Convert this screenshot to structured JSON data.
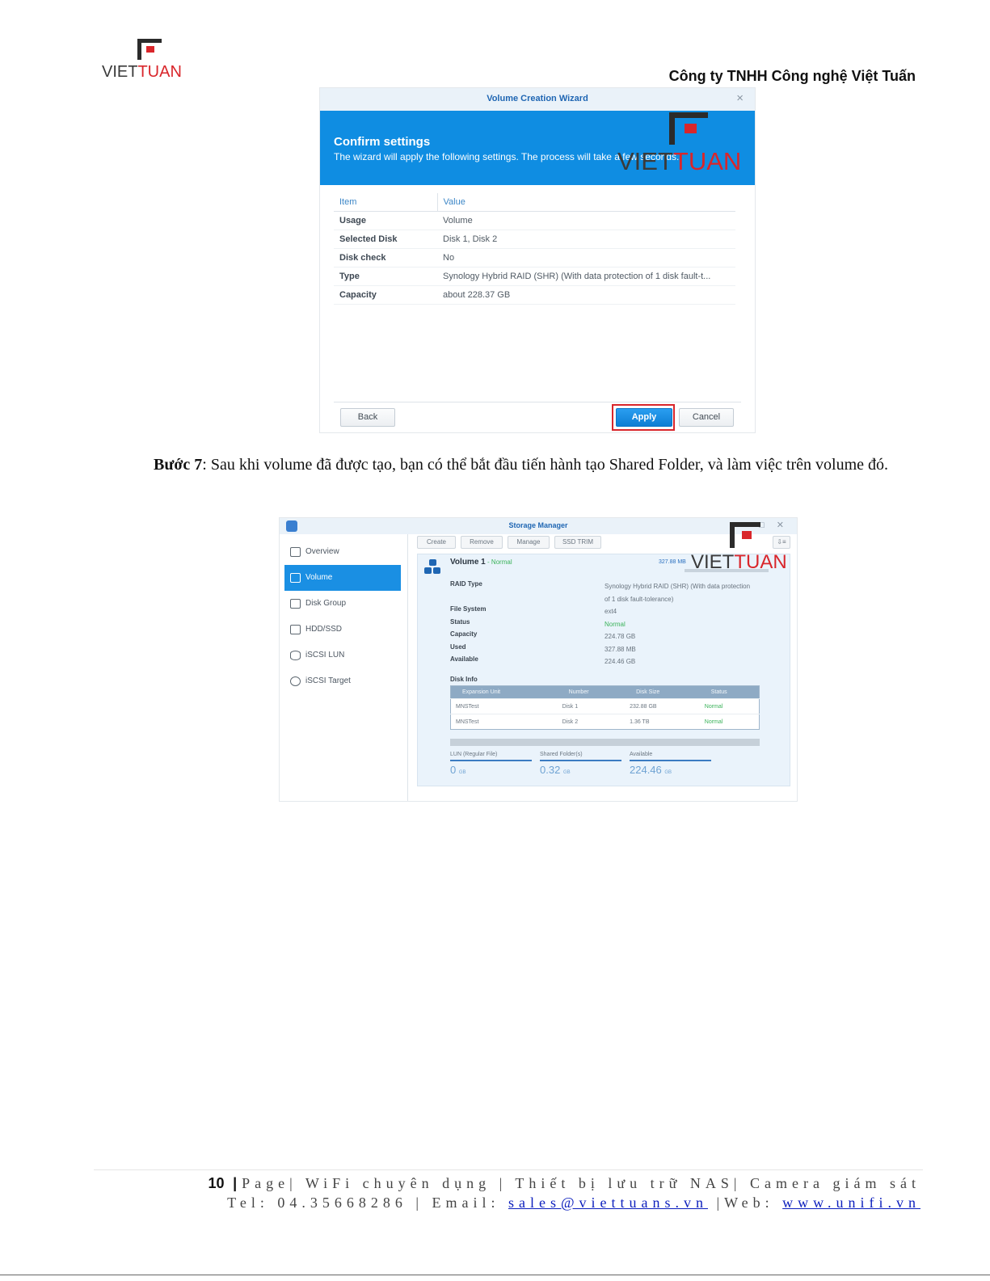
{
  "header": {
    "logo_part1": "VIET",
    "logo_part2": "TUAN",
    "company_name": "Công ty TNHH Công nghệ Việt Tuấn"
  },
  "wizard": {
    "window_title": "Volume Creation Wizard",
    "close_icon": "×",
    "heading": "Confirm settings",
    "subheading": "The wizard will apply the following settings. The process will take a few seconds.",
    "table_headers": {
      "item": "Item",
      "value": "Value"
    },
    "rows": [
      {
        "item": "Usage",
        "value": "Volume"
      },
      {
        "item": "Selected Disk",
        "value": "Disk 1, Disk 2"
      },
      {
        "item": "Disk check",
        "value": "No"
      },
      {
        "item": "Type",
        "value": "Synology Hybrid RAID (SHR) (With data protection of 1 disk fault-t..."
      },
      {
        "item": "Capacity",
        "value": "about 228.37 GB"
      }
    ],
    "buttons": {
      "back": "Back",
      "apply": "Apply",
      "cancel": "Cancel"
    }
  },
  "step": {
    "label": "Bước 7",
    "text": ": Sau khi volume đã được tạo, bạn có thể bắt đầu tiến hành tạo Shared Folder, và làm việc trên volume đó."
  },
  "storage_manager": {
    "window_title": "Storage Manager",
    "window_controls": "□ ✕",
    "sidebar": [
      {
        "label": "Overview",
        "icon": "overview-icon"
      },
      {
        "label": "Volume",
        "icon": "volume-icon",
        "active": true
      },
      {
        "label": "Disk Group",
        "icon": "disk-group-icon"
      },
      {
        "label": "HDD/SSD",
        "icon": "hdd-icon"
      },
      {
        "label": "iSCSI LUN",
        "icon": "lun-icon"
      },
      {
        "label": "iSCSI Target",
        "icon": "target-icon"
      }
    ],
    "toolbar": {
      "create": "Create",
      "remove": "Remove",
      "manage": "Manage",
      "ssd_trim": "SSD TRIM",
      "sort_icon": "⇩≡"
    },
    "volume_name": "Volume 1",
    "volume_status": " - Normal",
    "used_label": "327.88 MB",
    "properties": [
      {
        "key": "RAID Type",
        "value": "Synology Hybrid RAID (SHR) (With data protection of 1 disk fault-tolerance)"
      },
      {
        "key": "File System",
        "value": "ext4"
      },
      {
        "key": "Status",
        "value": "Normal"
      },
      {
        "key": "Capacity",
        "value": "224.78 GB"
      },
      {
        "key": "Used",
        "value": "327.88 MB"
      },
      {
        "key": "Available",
        "value": "224.46 GB"
      }
    ],
    "disk_info_label": "Disk Info",
    "disk_headers": [
      "Expansion Unit",
      "Number",
      "Disk Size",
      "Status"
    ],
    "disks": [
      {
        "unit": "MNSTest",
        "number": "Disk 1",
        "size": "232.88 GB",
        "status": "Normal"
      },
      {
        "unit": "MNSTest",
        "number": "Disk 2",
        "size": "1.36 TB",
        "status": "Normal"
      }
    ],
    "stats": [
      {
        "label": "LUN (Regular File)",
        "value": "0",
        "unit": "GB"
      },
      {
        "label": "Shared Folder(s)",
        "value": "0.32",
        "unit": "GB"
      },
      {
        "label": "Available",
        "value": "224.46",
        "unit": "GB"
      }
    ]
  },
  "footer": {
    "page_number": "10",
    "page_sep": "|",
    "line1": "Page| WiFi chuyên dụng | Thiết bị lưu trữ NAS| Camera giám sát",
    "tel": "Tel: 04.35668286 | Email: ",
    "email": "sales@viettuans.vn",
    "web_label": " |Web: ",
    "web": "www.unifi.vn"
  },
  "colors": {
    "brand_red": "#d9262b",
    "dsm_blue": "#0f8de2",
    "status_green": "#3bb35a"
  }
}
